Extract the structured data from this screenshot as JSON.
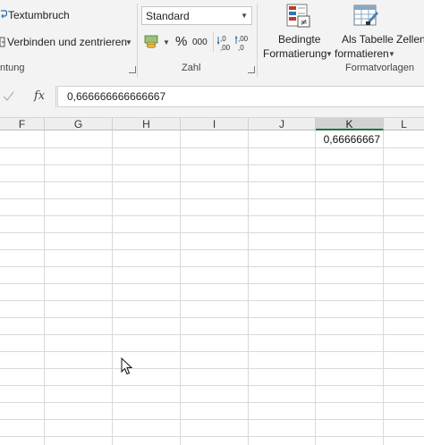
{
  "ribbon": {
    "wrap_text": "Textumbruch",
    "merge_center": "Verbinden und zentrieren",
    "alignment_group": "ntung",
    "number_format": "Standard",
    "percent_symbol": "%",
    "thousands_symbol": "000",
    "number_group": "Zahl",
    "conditional_line1": "Bedingte",
    "conditional_line2": "Formatierung",
    "as_table_line1": "Als Tabelle",
    "as_table_line2": "formatieren",
    "cell_styles_partial": "Zellen",
    "styles_group": "Formatvorlagen"
  },
  "formula_bar": {
    "fx_label": "fx",
    "value": "0,666666666666667"
  },
  "columns": [
    "F",
    "G",
    "H",
    "I",
    "J",
    "K",
    "L"
  ],
  "selected_column": "K",
  "cells": {
    "K1": "0,66666667"
  },
  "colors": {
    "accent": "#217346",
    "ribbon_bg": "#f3f3f3",
    "gridline": "#d9d9d9"
  }
}
